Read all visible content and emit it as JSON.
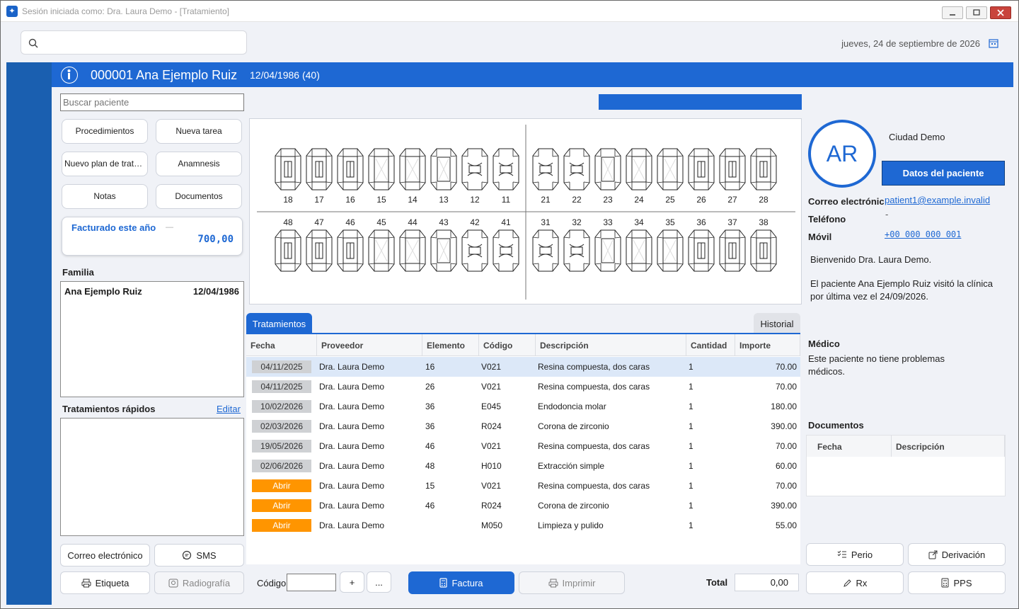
{
  "window": {
    "title": "Sesión iniciada como: Dra. Laura Demo - [Tratamiento]"
  },
  "top": {
    "search_placeholder": "",
    "date": "jueves, 24 de septiembre de 2026"
  },
  "patient": {
    "id_name": "000001 Ana Ejemplo Ruiz",
    "dob_age": "12/04/1986 (40)",
    "initials": "AR",
    "city": "Ciudad Demo"
  },
  "left": {
    "search_placeholder": "Buscar paciente",
    "buttons": [
      "Procedimientos",
      "Nueva tarea",
      "Nuevo plan de trata...",
      "Anamnesis",
      "Notas",
      "Documentos"
    ],
    "billing": {
      "label": "Facturado este año",
      "value": "700,00"
    },
    "family_label": "Familia",
    "family": [
      {
        "name": "Ana Ejemplo Ruiz",
        "dob": "12/04/1986"
      }
    ],
    "quick_label": "Tratamientos rápidos",
    "quick_edit": "Editar",
    "email_btn": "Correo electrónico",
    "sms_btn": "SMS",
    "label_btn": "Etiqueta",
    "xray_btn": "Radiografía"
  },
  "teeth": {
    "upper": [
      "18",
      "17",
      "16",
      "15",
      "14",
      "13",
      "12",
      "11",
      "21",
      "22",
      "23",
      "24",
      "25",
      "26",
      "27",
      "28"
    ],
    "lower": [
      "48",
      "47",
      "46",
      "45",
      "44",
      "43",
      "42",
      "41",
      "31",
      "32",
      "33",
      "34",
      "35",
      "36",
      "37",
      "38"
    ]
  },
  "tabs": {
    "active": "Tratamientos",
    "other": "Historial"
  },
  "grid": {
    "headers": [
      "Fecha",
      "Proveedor",
      "Elemento",
      "Código",
      "Descripción",
      "Cantidad",
      "Importe"
    ],
    "rows": [
      {
        "fecha": "04/11/2025",
        "open": false,
        "prov": "Dra. Laura Demo",
        "elem": "16",
        "cod": "V021",
        "desc": "Resina compuesta, dos caras",
        "cant": "1",
        "imp": "70.00"
      },
      {
        "fecha": "04/11/2025",
        "open": false,
        "prov": "Dra. Laura Demo",
        "elem": "26",
        "cod": "V021",
        "desc": "Resina compuesta, dos caras",
        "cant": "1",
        "imp": "70.00"
      },
      {
        "fecha": "10/02/2026",
        "open": false,
        "prov": "Dra. Laura Demo",
        "elem": "36",
        "cod": "E045",
        "desc": "Endodoncia molar",
        "cant": "1",
        "imp": "180.00"
      },
      {
        "fecha": "02/03/2026",
        "open": false,
        "prov": "Dra. Laura Demo",
        "elem": "36",
        "cod": "R024",
        "desc": "Corona de zirconio",
        "cant": "1",
        "imp": "390.00"
      },
      {
        "fecha": "19/05/2026",
        "open": false,
        "prov": "Dra. Laura Demo",
        "elem": "46",
        "cod": "V021",
        "desc": "Resina compuesta, dos caras",
        "cant": "1",
        "imp": "70.00"
      },
      {
        "fecha": "02/06/2026",
        "open": false,
        "prov": "Dra. Laura Demo",
        "elem": "48",
        "cod": "H010",
        "desc": "Extracción simple",
        "cant": "1",
        "imp": "60.00"
      },
      {
        "fecha": "Abrir",
        "open": true,
        "prov": "Dra. Laura Demo",
        "elem": "15",
        "cod": "V021",
        "desc": "Resina compuesta, dos caras",
        "cant": "1",
        "imp": "70.00"
      },
      {
        "fecha": "Abrir",
        "open": true,
        "prov": "Dra. Laura Demo",
        "elem": "46",
        "cod": "R024",
        "desc": "Corona de zirconio",
        "cant": "1",
        "imp": "390.00"
      },
      {
        "fecha": "Abrir",
        "open": true,
        "prov": "Dra. Laura Demo",
        "elem": "",
        "cod": "M050",
        "desc": "Limpieza y pulido",
        "cant": "1",
        "imp": "55.00"
      }
    ]
  },
  "bottom": {
    "code_label": "Código",
    "plus": "+",
    "more": "...",
    "invoice_btn": "Factura",
    "print_btn": "Imprimir",
    "total_label": "Total",
    "total_value": "0,00"
  },
  "right": {
    "data_btn": "Datos del paciente",
    "email_label": "Correo electrónic",
    "email_value": "patient1@example.invalid",
    "phone_label": "Teléfono",
    "phone_value": "-",
    "mobile_label": "Móvil",
    "mobile_value": "+00 000 000 001",
    "welcome": "Bienvenido Dra. Laura Demo.",
    "last_visit": "El paciente Ana Ejemplo Ruiz visitó la clínica por última vez el 24/09/2026.",
    "medical_label": "Médico",
    "medical_text": "Este paciente no tiene problemas médicos.",
    "docs_label": "Documentos",
    "docs_headers": [
      "Fecha",
      "Descripción"
    ],
    "perio_btn": "Perio",
    "deriv_btn": "Derivación",
    "rx_btn": "Rx",
    "pps_btn": "PPS"
  },
  "colors": {
    "accent": "#1e68d3",
    "open": "#ff9500",
    "sidebar": "#1a5fb0"
  }
}
